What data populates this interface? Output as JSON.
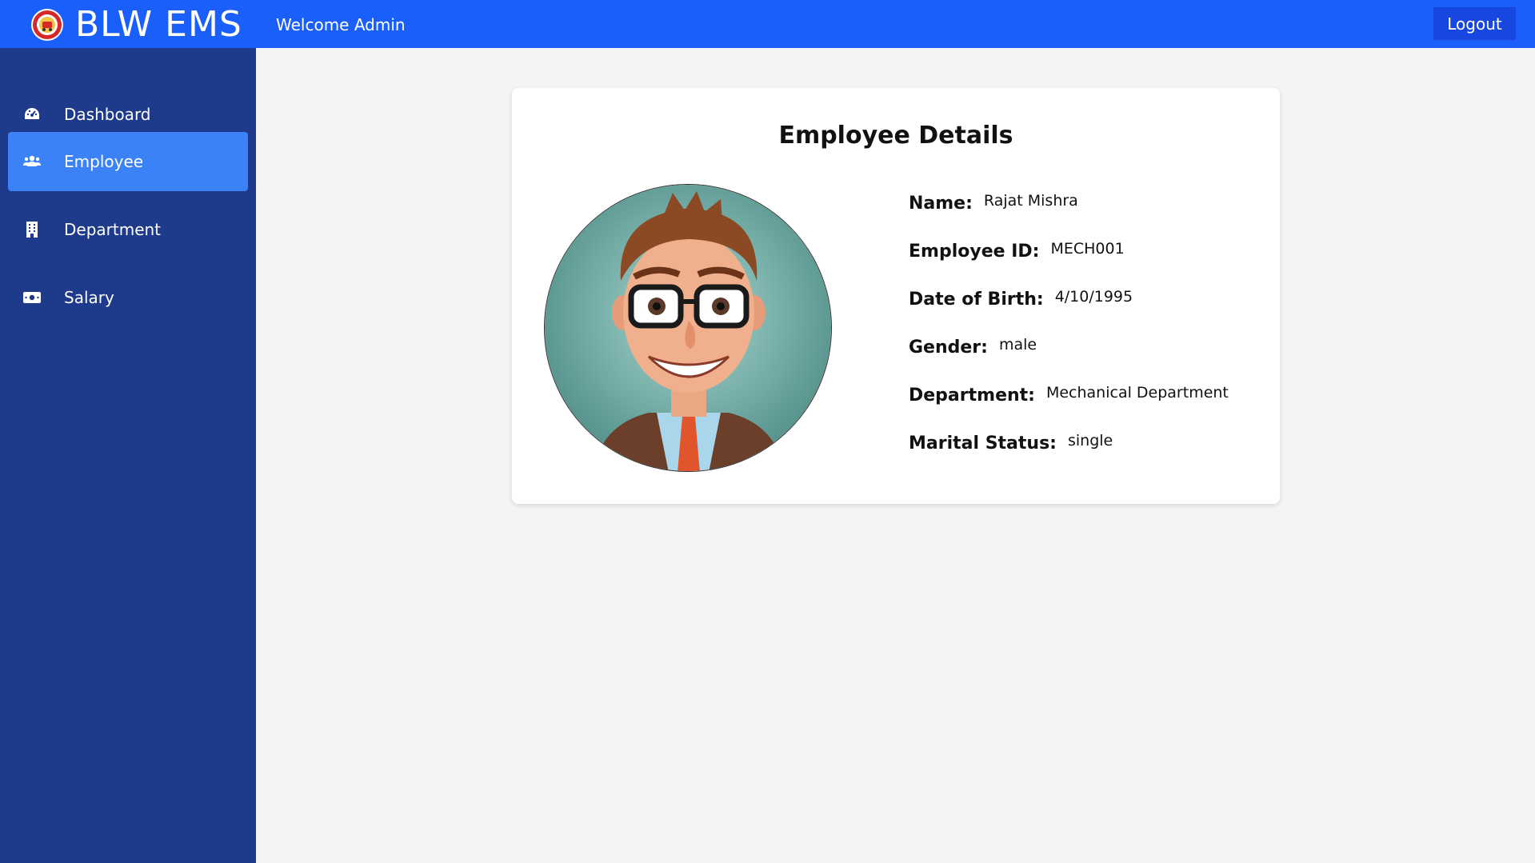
{
  "header": {
    "brand": "BLW EMS",
    "welcome": "Welcome Admin",
    "logout_label": "Logout",
    "logo_icon": "railway-emblem-icon"
  },
  "sidebar": {
    "items": [
      {
        "label": "Dashboard",
        "icon": "tachometer-icon",
        "active": false
      },
      {
        "label": "Employee",
        "icon": "users-icon",
        "active": true
      },
      {
        "label": "Department",
        "icon": "building-icon",
        "active": false
      },
      {
        "label": "Salary",
        "icon": "money-bill-icon",
        "active": false
      }
    ]
  },
  "main": {
    "title": "Employee Details",
    "fields": [
      {
        "label": "Name:",
        "value": "Rajat Mishra"
      },
      {
        "label": "Employee ID:",
        "value": "MECH001"
      },
      {
        "label": "Date of Birth:",
        "value": "4/10/1995"
      },
      {
        "label": "Gender:",
        "value": "male"
      },
      {
        "label": "Department:",
        "value": "Mechanical Department"
      },
      {
        "label": "Marital Status:",
        "value": "single"
      }
    ]
  },
  "colors": {
    "topbar": "#1a5ffa",
    "sidebar": "#1e3a8a",
    "active_nav": "#3b82f6",
    "logout_button": "#1847e0",
    "page_background": "#f3f4f6"
  }
}
